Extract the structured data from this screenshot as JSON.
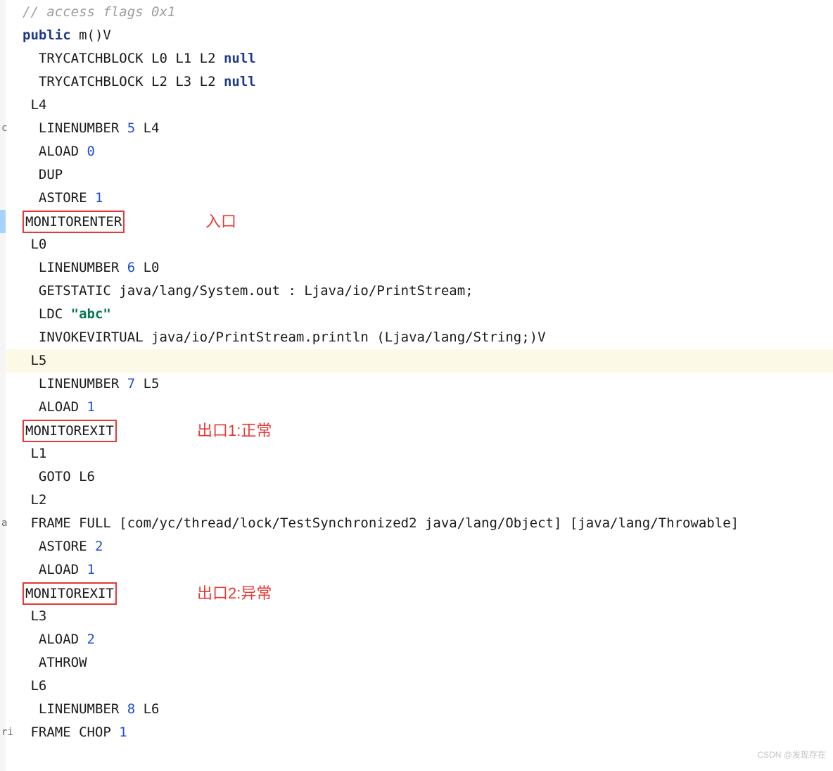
{
  "comment": "// access flags 0x1",
  "sig": {
    "kw": "public",
    "method": " m()V"
  },
  "tcb1": {
    "pre": "  TRYCATCHBLOCK L0 L1 L2 ",
    "kw": "null"
  },
  "tcb2": {
    "pre": "  TRYCATCHBLOCK L2 L3 L2 ",
    "kw": "null"
  },
  "L4": " L4",
  "ln5": {
    "a": "  LINENUMBER ",
    "n": "5",
    "b": " L4"
  },
  "aload0": {
    "a": "  ALOAD ",
    "n": "0"
  },
  "dup": "  DUP",
  "astore1": {
    "a": "  ASTORE ",
    "n": "1"
  },
  "monitorenter": "MONITORENTER",
  "anno_enter": "入口",
  "L0": " L0",
  "ln6": {
    "a": "  LINENUMBER ",
    "n": "6",
    "b": " L0"
  },
  "getstatic": "  GETSTATIC java/lang/System.out : Ljava/io/PrintStream;",
  "ldc": {
    "a": "  LDC ",
    "s": "\"abc\""
  },
  "invokevirtual": "  INVOKEVIRTUAL java/io/PrintStream.println (Ljava/lang/String;)V",
  "L5": " L5",
  "ln7": {
    "a": "  LINENUMBER ",
    "n": "7",
    "b": " L5"
  },
  "aload1a": {
    "a": "  ALOAD ",
    "n": "1"
  },
  "monitorexit1": "MONITOREXIT",
  "anno_exit1": "出口1:正常",
  "L1": " L1",
  "goto6": "  GOTO L6",
  "L2": " L2",
  "framefull": " FRAME FULL [com/yc/thread/lock/TestSynchronized2 java/lang/Object] [java/lang/Throwable]",
  "astore2": {
    "a": "  ASTORE ",
    "n": "2"
  },
  "aload1b": {
    "a": "  ALOAD ",
    "n": "1"
  },
  "monitorexit2": "MONITOREXIT",
  "anno_exit2": "出口2:异常",
  "L3": " L3",
  "aload2": {
    "a": "  ALOAD ",
    "n": "2"
  },
  "athrow": "  ATHROW",
  "L6": " L6",
  "ln8": {
    "a": "  LINENUMBER ",
    "n": "8",
    "b": " L6"
  },
  "framechop": {
    "a": " FRAME CHOP ",
    "n": "1"
  },
  "gutter_c": "c",
  "gutter_a": "a",
  "gutter_ri": "ri",
  "watermark": "CSDN @发现存在"
}
